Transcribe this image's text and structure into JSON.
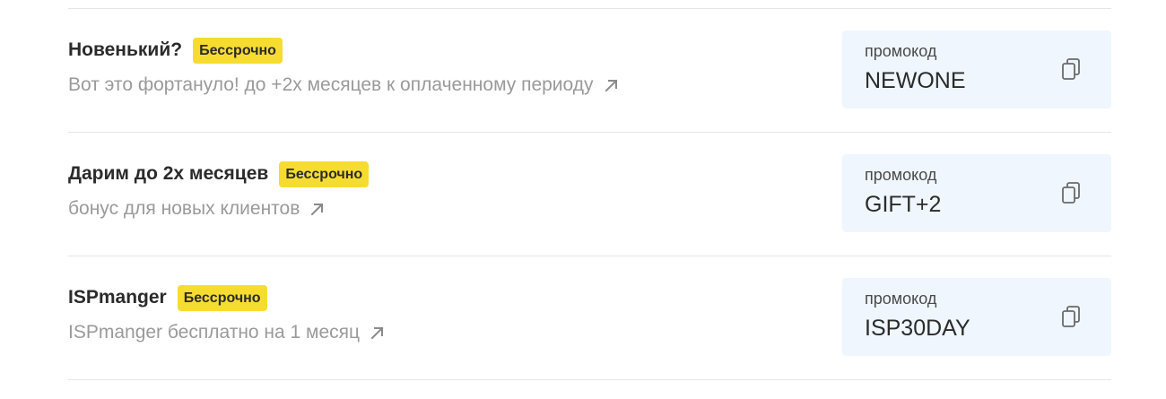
{
  "promos": [
    {
      "title": "Новенький?",
      "badge": "Бессрочно",
      "description": "Вот это фортануло! до +2х месяцев к оплаченному периоду",
      "promo_label": "промокод",
      "code": "NEWONE"
    },
    {
      "title": "Дарим до 2х месяцев",
      "badge": "Бессрочно",
      "description": "бонус для новых клиентов",
      "promo_label": "промокод",
      "code": "GIFT+2"
    },
    {
      "title": "ISPmanger",
      "badge": "Бессрочно",
      "description": "ISPmanger бесплатно на 1 месяц",
      "promo_label": "промокод",
      "code": "ISP30DAY"
    }
  ],
  "icons": {
    "link": "arrow-up-right-icon",
    "copy": "copy-icon"
  },
  "colors": {
    "badge_bg": "#f7dc30",
    "promo_bg": "#eff6fd",
    "title": "#2b2b2b",
    "description": "#9a9a9a",
    "divider": "#e6e6e6"
  }
}
